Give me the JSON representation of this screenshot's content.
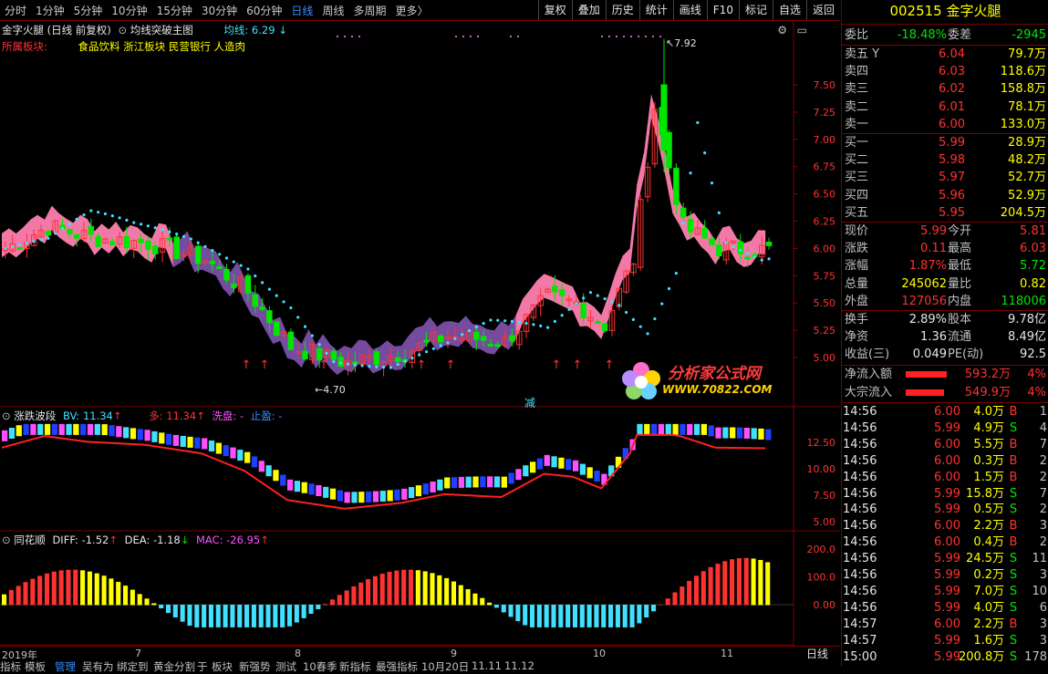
{
  "toolbar": {
    "periods": [
      "分时",
      "1分钟",
      "5分钟",
      "10分钟",
      "15分钟",
      "30分钟",
      "60分钟",
      "日线",
      "周线",
      "多周期",
      "更多〉"
    ],
    "active_period": "日线",
    "tools": [
      "复权",
      "叠加",
      "历史",
      "统计",
      "画线",
      "F10",
      "标记",
      "自选",
      "返回"
    ]
  },
  "main_pane": {
    "title": "金字火腿 (日线 前复权)",
    "indicator_name": "均线突破主图",
    "ma_label": "均线: 6.29",
    "sector_prefix": "所属板块:",
    "sectors": "食品饮料 浙江板块 民营银行 人造肉",
    "high_label": "7.92",
    "low_label": "4.70",
    "reduce_label": "减",
    "y_ticks": [
      "7.50",
      "7.25",
      "7.00",
      "6.75",
      "6.50",
      "6.25",
      "6.00",
      "5.75",
      "5.50",
      "5.25",
      "5.00"
    ]
  },
  "watermark": {
    "brand": "分析家公式网",
    "url": "WWW.70822.COM"
  },
  "pane2": {
    "name": "涨跌波段",
    "bv": "BV: 11.34",
    "duo": "多: 11.34",
    "xipan": "洗盘: -",
    "zhiying": "止盈: -",
    "y_ticks": [
      "12.50",
      "10.00",
      "7.50",
      "5.00"
    ]
  },
  "pane3": {
    "name": "同花顺",
    "diff": "DIFF: -1.52",
    "dea": "DEA: -1.18",
    "mac": "MAC: -26.95",
    "y_ticks": [
      "200.0",
      "100.0",
      "0.00"
    ]
  },
  "x_axis": [
    "2019年",
    "7",
    "8",
    "9",
    "10",
    "11"
  ],
  "bottom_tabs": [
    "指标",
    "模板",
    "管理",
    "吴有为",
    "绑定到",
    "黄金分割",
    "于",
    "板块",
    "新强势",
    "测试",
    "10春季",
    "新指标",
    "最强指标",
    "10月20日",
    "11.11",
    "11.12"
  ],
  "bottom_active": "管理",
  "bottom_period": "日线",
  "quote": {
    "code": "002515",
    "name": "金字火腿",
    "weibi_label": "委比",
    "weibi": "-18.48%",
    "weicha_label": "委差",
    "weicha": "-2945",
    "sells": [
      {
        "label": "卖五",
        "flag": "Y",
        "price": "6.04",
        "vol": "79.7万"
      },
      {
        "label": "卖四",
        "flag": "",
        "price": "6.03",
        "vol": "118.6万"
      },
      {
        "label": "卖三",
        "flag": "",
        "price": "6.02",
        "vol": "158.8万"
      },
      {
        "label": "卖二",
        "flag": "",
        "price": "6.01",
        "vol": "78.1万"
      },
      {
        "label": "卖一",
        "flag": "",
        "price": "6.00",
        "vol": "133.0万"
      }
    ],
    "buys": [
      {
        "label": "买一",
        "price": "5.99",
        "vol": "28.9万"
      },
      {
        "label": "买二",
        "price": "5.98",
        "vol": "48.2万"
      },
      {
        "label": "买三",
        "price": "5.97",
        "vol": "52.7万"
      },
      {
        "label": "买四",
        "price": "5.96",
        "vol": "52.9万"
      },
      {
        "label": "买五",
        "price": "5.95",
        "vol": "204.5万"
      }
    ],
    "stats": [
      {
        "l1": "现价",
        "v1": "5.99",
        "c1": "red",
        "l2": "今开",
        "v2": "5.81",
        "c2": "red"
      },
      {
        "l1": "涨跌",
        "v1": "0.11",
        "c1": "red",
        "l2": "最高",
        "v2": "6.03",
        "c2": "red"
      },
      {
        "l1": "涨幅",
        "v1": "1.87%",
        "c1": "red",
        "l2": "最低",
        "v2": "5.72",
        "c2": "green"
      },
      {
        "l1": "总量",
        "v1": "245062",
        "c1": "yellow",
        "l2": "量比",
        "v2": "0.82",
        "c2": "yellow"
      },
      {
        "l1": "外盘",
        "v1": "127056",
        "c1": "red",
        "l2": "内盘",
        "v2": "118006",
        "c2": "green"
      }
    ],
    "stats2": [
      {
        "l1": "换手",
        "v1": "2.89%",
        "l2": "股本",
        "v2": "9.78亿"
      },
      {
        "l1": "净资",
        "v1": "1.36",
        "l2": "流通",
        "v2": "8.49亿"
      },
      {
        "l1": "收益(三)",
        "v1": "0.049",
        "l2": "PE(动)",
        "v2": "92.5"
      }
    ],
    "flows": [
      {
        "label": "净流入额",
        "value": "593.2万",
        "pct": "4%",
        "bar": 0.62
      },
      {
        "label": "大宗流入",
        "value": "549.9万",
        "pct": "4%",
        "bar": 0.58
      }
    ],
    "ticks": [
      {
        "t": "14:56",
        "p": "6.00",
        "v": "4.0万",
        "bs": "B",
        "n": "1"
      },
      {
        "t": "14:56",
        "p": "5.99",
        "v": "4.9万",
        "bs": "S",
        "n": "4"
      },
      {
        "t": "14:56",
        "p": "6.00",
        "v": "5.5万",
        "bs": "B",
        "n": "7"
      },
      {
        "t": "14:56",
        "p": "6.00",
        "v": "0.3万",
        "bs": "B",
        "n": "2"
      },
      {
        "t": "14:56",
        "p": "6.00",
        "v": "1.5万",
        "bs": "B",
        "n": "2"
      },
      {
        "t": "14:56",
        "p": "5.99",
        "v": "15.8万",
        "bs": "S",
        "n": "7"
      },
      {
        "t": "14:56",
        "p": "5.99",
        "v": "0.5万",
        "bs": "S",
        "n": "2"
      },
      {
        "t": "14:56",
        "p": "6.00",
        "v": "2.2万",
        "bs": "B",
        "n": "3"
      },
      {
        "t": "14:56",
        "p": "6.00",
        "v": "0.4万",
        "bs": "B",
        "n": "2"
      },
      {
        "t": "14:56",
        "p": "5.99",
        "v": "24.5万",
        "bs": "S",
        "n": "11"
      },
      {
        "t": "14:56",
        "p": "5.99",
        "v": "0.2万",
        "bs": "S",
        "n": "3"
      },
      {
        "t": "14:56",
        "p": "5.99",
        "v": "7.0万",
        "bs": "S",
        "n": "10"
      },
      {
        "t": "14:56",
        "p": "5.99",
        "v": "4.0万",
        "bs": "S",
        "n": "6"
      },
      {
        "t": "14:57",
        "p": "6.00",
        "v": "2.2万",
        "bs": "B",
        "n": "3"
      },
      {
        "t": "14:57",
        "p": "5.99",
        "v": "1.6万",
        "bs": "S",
        "n": "3"
      },
      {
        "t": "15:00",
        "p": "5.99",
        "v": "200.8万",
        "bs": "S",
        "n": "178"
      }
    ]
  },
  "colors": {
    "up": "#ff3232",
    "down": "#00e600",
    "cyan": "#40e0ff",
    "pink": "#ff80b0",
    "purple": "#7a4fa8",
    "border": "#7a0000",
    "active": "#3a8cff"
  }
}
